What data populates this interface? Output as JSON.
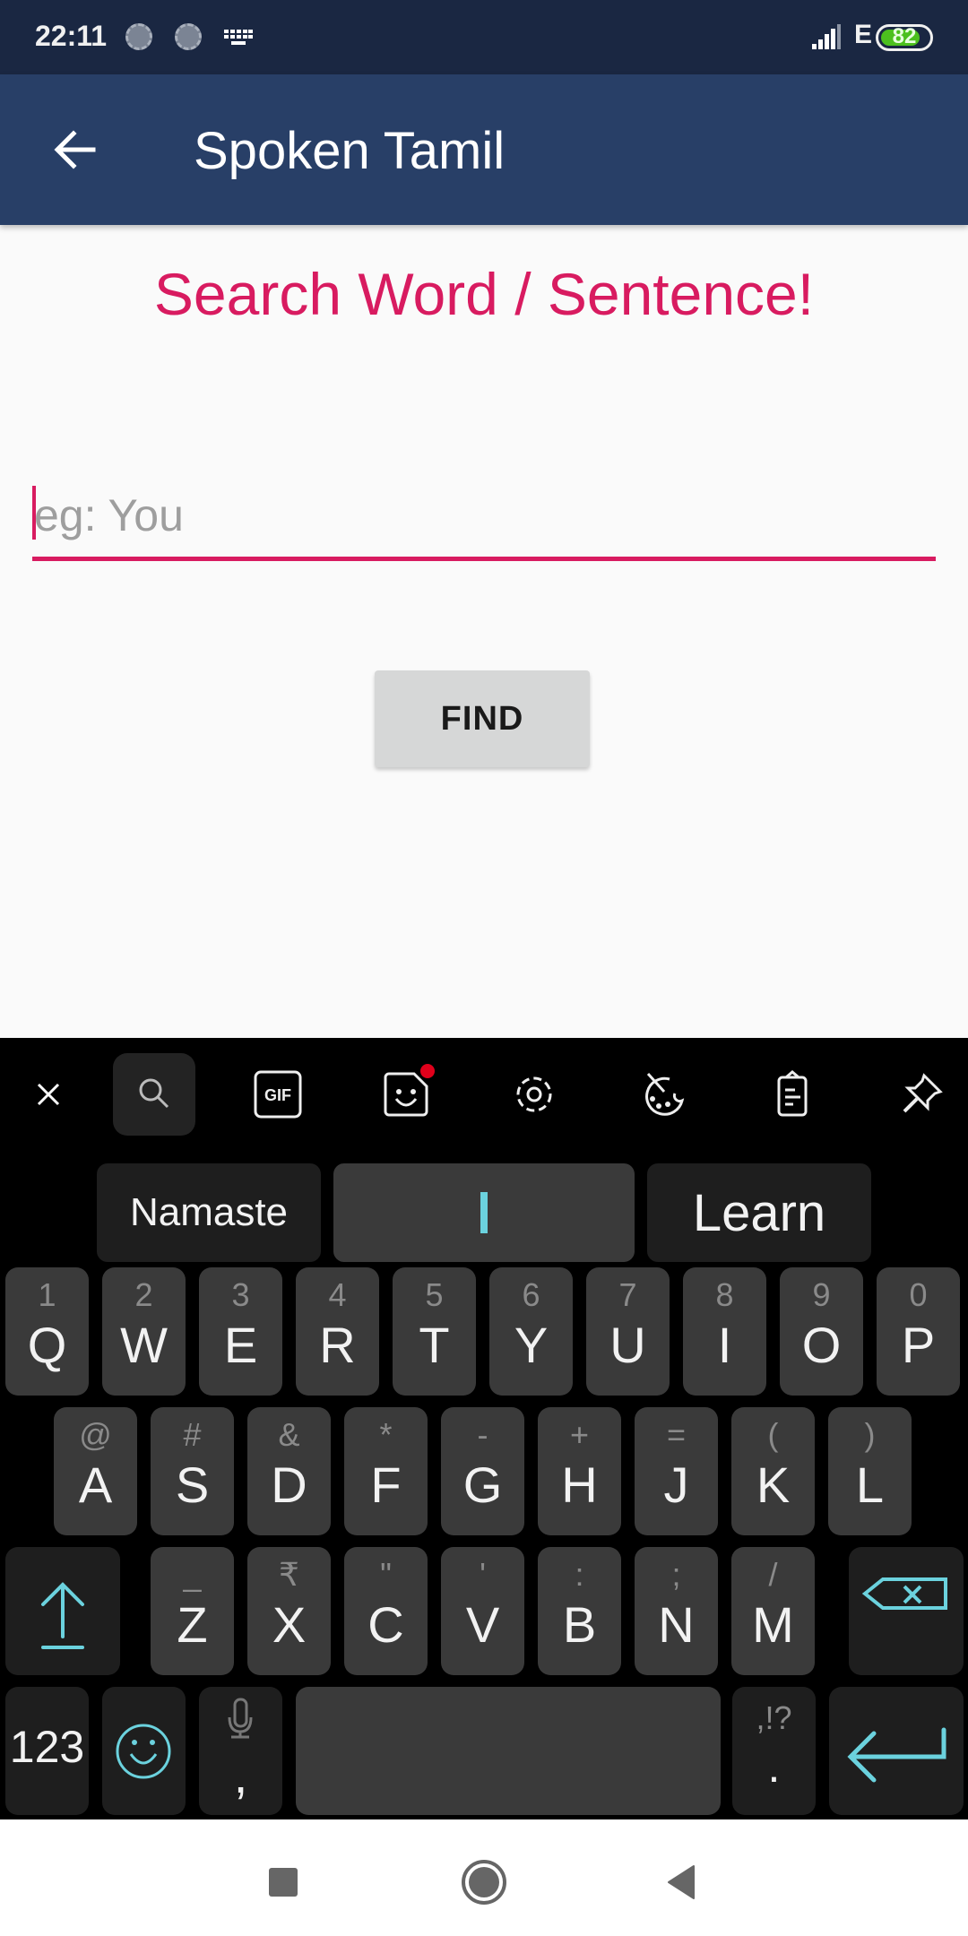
{
  "status_bar": {
    "time": "22:11",
    "network_type": "E",
    "battery_percent": "82",
    "battery_level": 0.82,
    "icons": [
      "sync-icon",
      "sync-icon",
      "keyboard-icon",
      "signal-icon",
      "battery-icon"
    ]
  },
  "app_bar": {
    "back_icon": "arrow-left-icon",
    "title": "Spoken Tamil"
  },
  "main": {
    "heading": "Search Word / Sentence!",
    "search_input": {
      "value": "",
      "placeholder": "eg: You"
    },
    "find_button": "FIND",
    "accent_color": "#d81b60"
  },
  "keyboard": {
    "toolbar": [
      "close-icon",
      "search-icon",
      "gif-icon",
      "sticker-icon",
      "settings-icon",
      "theme-palette-icon",
      "clipboard-icon",
      "pin-icon"
    ],
    "gif_label": "GIF",
    "suggestions": [
      "Namaste",
      "I",
      "Learn"
    ],
    "rows": [
      [
        {
          "main": "Q",
          "alt": "1"
        },
        {
          "main": "W",
          "alt": "2"
        },
        {
          "main": "E",
          "alt": "3"
        },
        {
          "main": "R",
          "alt": "4"
        },
        {
          "main": "T",
          "alt": "5"
        },
        {
          "main": "Y",
          "alt": "6"
        },
        {
          "main": "U",
          "alt": "7"
        },
        {
          "main": "I",
          "alt": "8"
        },
        {
          "main": "O",
          "alt": "9"
        },
        {
          "main": "P",
          "alt": "0"
        }
      ],
      [
        {
          "main": "A",
          "alt": "@"
        },
        {
          "main": "S",
          "alt": "#"
        },
        {
          "main": "D",
          "alt": "&"
        },
        {
          "main": "F",
          "alt": "*"
        },
        {
          "main": "G",
          "alt": "-"
        },
        {
          "main": "H",
          "alt": "+"
        },
        {
          "main": "J",
          "alt": "="
        },
        {
          "main": "K",
          "alt": "("
        },
        {
          "main": "L",
          "alt": ")"
        }
      ],
      [
        {
          "main": "Z",
          "alt": "_"
        },
        {
          "main": "X",
          "alt": "₹"
        },
        {
          "main": "C",
          "alt": "\""
        },
        {
          "main": "V",
          "alt": "'"
        },
        {
          "main": "B",
          "alt": ":"
        },
        {
          "main": "N",
          "alt": ";"
        },
        {
          "main": "M",
          "alt": "/"
        }
      ]
    ],
    "bottom": {
      "numbers_label": "123",
      "comma_label": ",",
      "period_alt": ",!?",
      "period_label": "."
    },
    "accent_color": "#6bd2de"
  },
  "nav_bar": {
    "buttons": [
      "recents-icon",
      "home-icon",
      "back-icon"
    ]
  }
}
